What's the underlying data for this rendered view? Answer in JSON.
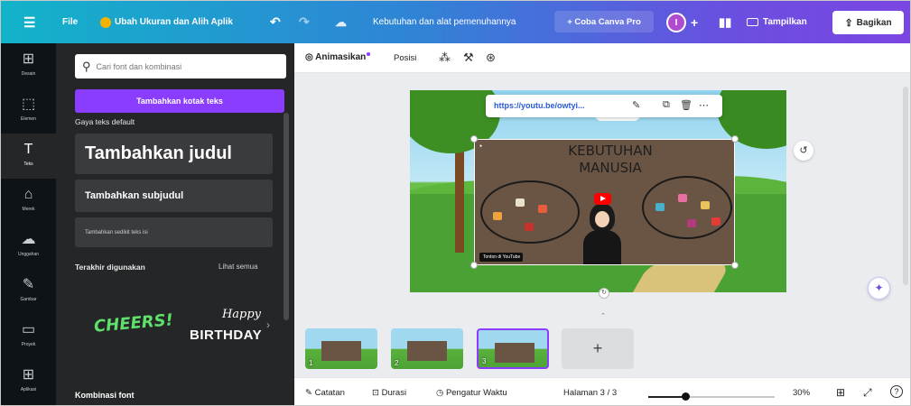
{
  "topbar": {
    "menu_icon": "hamburger-icon",
    "file_label": "File",
    "resize_label": "Ubah Ukuran dan Alih Aplik",
    "undo_icon": "undo-icon",
    "redo_icon": "redo-icon",
    "cloud_icon": "cloud-sync-icon",
    "doc_title": "Kebutuhan dan alat pemenuhannya",
    "try_pro_label": "+ Coba Canva Pro",
    "avatar_letter": "I",
    "add_member": "+",
    "stats_icon": "bar-chart-icon",
    "present_label": "Tampilkan",
    "share_label": "Bagikan",
    "colors": {
      "gradient_start": "#12b3c9",
      "gradient_end": "#7b46e2"
    }
  },
  "rail": {
    "items": [
      {
        "icon": "templates-icon",
        "glyph": "⊞",
        "label": "Desain"
      },
      {
        "icon": "elements-icon",
        "glyph": "⬚",
        "label": "Elemen"
      },
      {
        "icon": "text-icon",
        "glyph": "T",
        "label": "Teks"
      },
      {
        "icon": "brand-icon",
        "glyph": "⌂",
        "label": "Merek"
      },
      {
        "icon": "uploads-icon",
        "glyph": "☁",
        "label": "Unggahan"
      },
      {
        "icon": "draw-icon",
        "glyph": "✎",
        "label": "Gambar"
      },
      {
        "icon": "projects-icon",
        "glyph": "▭",
        "label": "Proyek"
      },
      {
        "icon": "apps-icon",
        "glyph": "⊞",
        "label": "Aplikasi"
      }
    ]
  },
  "panel": {
    "search_placeholder": "Cari font dan kombinasi",
    "add_textbox_label": "Tambahkan kotak teks",
    "default_styles_label": "Gaya teks default",
    "heading_label": "Tambahkan judul",
    "subheading_label": "Tambahkan subjudul",
    "body_label": "Tambahkan sedikit teks isi",
    "recent_label": "Terakhir digunakan",
    "see_all_label": "Lihat semua",
    "recent_fonts": {
      "cheers": "CHEERS!",
      "happy": "Happy",
      "birthday": "BIRTHDAY"
    },
    "combos_label": "Kombinasi font"
  },
  "editor_toolbar": {
    "animate_label": "Animasikan",
    "position_label": "Posisi",
    "accent": "#8b3dff"
  },
  "canvas": {
    "link_url": "https://youtu.be/owtyi...",
    "video": {
      "title_line1": "KEBUTUHAN",
      "title_line2": "MANUSIA",
      "watch_label": "Tonton di YouTube"
    }
  },
  "pages": {
    "thumbnails": [
      {
        "number": "1",
        "selected": false
      },
      {
        "number": "2",
        "selected": false
      },
      {
        "number": "3",
        "selected": true
      }
    ],
    "add_page_label": "+"
  },
  "bottombar": {
    "notes_label": "Catatan",
    "duration_label": "Durasi",
    "timer_label": "Pengatur Waktu",
    "page_indicator": "Halaman 3 / 3",
    "zoom_value": 0.29,
    "zoom_label": "30%",
    "help_label": "?"
  }
}
